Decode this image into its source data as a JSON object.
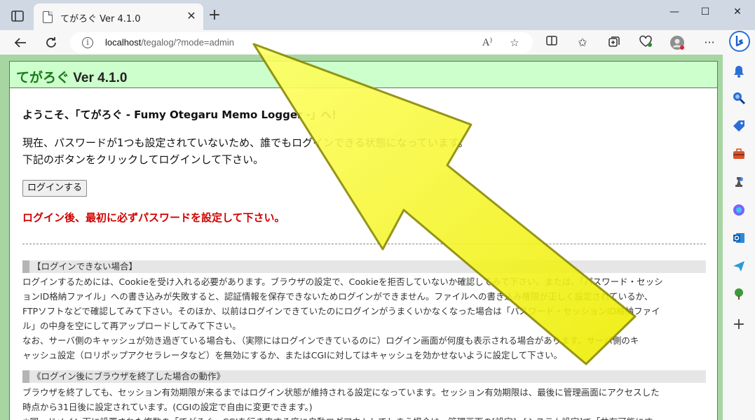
{
  "browser": {
    "tab_title": "てがろぐ Ver 4.1.0",
    "tab_close": "✕",
    "new_tab": "+",
    "window": {
      "minimize": "—",
      "maximize": "☐",
      "close": "✕"
    },
    "url_host": "localhost",
    "url_path": "/tegalog/?mode=admin",
    "read_aloud": "A⁾",
    "more": "···"
  },
  "page": {
    "app_name": "てがろぐ",
    "app_version": "Ver 4.1.0",
    "welcome": "ようこそ、「てがろぐ - Fumy Otegaru Memo Logger -」へ！",
    "message_line1": "現在、パスワードが1つも設定されていないため、誰でもログインできる状態になっています。",
    "message_line2": "下記のボタンをクリックしてログインして下さい。",
    "login_button": "ログインする",
    "warning": "ログイン後、最初に必ずパスワードを設定して下さい。",
    "section1": {
      "heading": "【ログインできない場合】",
      "lines": [
        "ログインするためには、Cookieを受け入れる必要があります。ブラウザの設定で、Cookieを拒否していないか確認してみて下さい。または、「パスワード・セッシ",
        "ョンID格納ファイル」への書き込みが失敗すると、認証情報を保存できないためログインができません。ファイルへの書き込み権限が正しく設定されているか、",
        "FTPソフトなどで確認してみて下さい。そのほか、以前はログインできていたのにログインがうまくいかなくなった場合は「パスワード・セッションID格納ファイ",
        "ル」の中身を空にして再アップロードしてみて下さい。",
        "なお、サーバ側のキャッシュが効き過ぎている場合も、（実際にはログインできているのに）ログイン画面が何度も表示される場合があります。サーバ側のキ",
        "ャッシュ設定（ロリポップアクセラレータなど）を無効にするか、またはCGIに対してはキャッシュを効かせないように設定して下さい。"
      ]
    },
    "section2": {
      "heading": "《ログイン後にブラウザを終了した場合の動作》",
      "lines": [
        "ブラウザを終了しても、セッション有効期限が来るまではログイン状態が維持される設定になっています。セッション有効期限は、最後に管理画面にアクセスした",
        "時点から31日後に設定されています。(CGIの設定で自由に変更できます。)",
        "※同一ドメイン下に設置された複数の「てがろぐ」CGIを行き来する度に自動ログアウトしてしまう場合は、管理画面の[設定]→[システム設定]で「共有可能にす"
      ]
    }
  },
  "colors": {
    "page_bg": "#a7d6a2",
    "header_bg": "#ccffcc",
    "warning": "#d10000",
    "arrow_fill": "#f2f20f",
    "arrow_stroke": "#8a8a00"
  },
  "icons": [
    "sidebar-toggle-icon",
    "back-icon",
    "refresh-icon",
    "info-icon",
    "favorite-icon",
    "split-screen-icon",
    "favorites-list-icon",
    "collections-icon",
    "heart-pulse-icon",
    "profile-icon",
    "more-icon",
    "bing-icon",
    "bell-icon",
    "search-icon",
    "shopping-tag-icon",
    "toolbox-icon",
    "chess-icon",
    "copilot-icon",
    "outlook-icon",
    "send-icon",
    "tree-icon",
    "add-icon"
  ]
}
